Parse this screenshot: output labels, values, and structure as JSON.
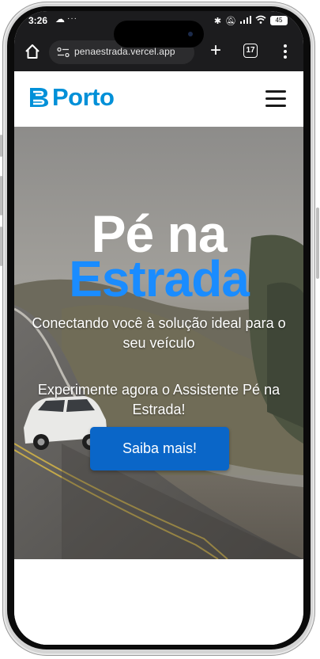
{
  "status_bar": {
    "time": "3:26",
    "cloud_icon": "cloud-icon",
    "dots": "···",
    "battery": "45"
  },
  "browser": {
    "url": "penaestrada.vercel.app",
    "tab_count": "17",
    "plus": "+",
    "menu": "⋮"
  },
  "header": {
    "logo_text": "Porto",
    "brand_color": "#0090d8"
  },
  "hero": {
    "title_line1": "Pé na",
    "title_line2": "Estrada",
    "subtitle": "Conectando você à solução ideal para o seu veículo",
    "cta_text": "Experimente agora o Assistente Pé na Estrada!",
    "button_label": "Saiba mais!",
    "accent_color": "#1a8cff",
    "button_color": "#0a66c8"
  }
}
